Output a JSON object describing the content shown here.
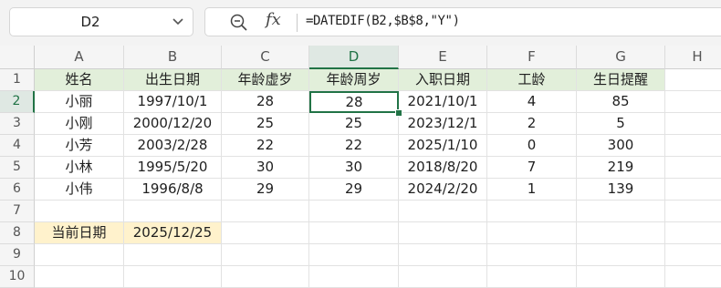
{
  "name_box": {
    "value": "D2"
  },
  "formula_bar": {
    "formula": "=DATEDIF(B2,$B$8,\"Y\")"
  },
  "selected_cell": {
    "column": "D",
    "row": "2"
  },
  "column_headers": [
    "A",
    "B",
    "C",
    "D",
    "E",
    "F",
    "G",
    "H"
  ],
  "row_headers": [
    "1",
    "2",
    "3",
    "4",
    "5",
    "6",
    "7",
    "8",
    "9",
    "10"
  ],
  "table": {
    "headers": [
      "姓名",
      "出生日期",
      "年龄虚岁",
      "年龄周岁",
      "入职日期",
      "工龄",
      "生日提醒"
    ],
    "rows": [
      [
        "小丽",
        "1997/10/1",
        "28",
        "28",
        "2021/10/1",
        "4",
        "85"
      ],
      [
        "小刚",
        "2000/12/20",
        "25",
        "25",
        "2023/12/1",
        "2",
        "5"
      ],
      [
        "小芳",
        "2003/2/28",
        "22",
        "22",
        "2025/1/10",
        "0",
        "300"
      ],
      [
        "小林",
        "1995/5/20",
        "30",
        "30",
        "2018/8/20",
        "7",
        "219"
      ],
      [
        "小伟",
        "1996/8/8",
        "29",
        "29",
        "2024/2/20",
        "1",
        "139"
      ]
    ]
  },
  "current_date": {
    "label": "当前日期",
    "value": "2025/12/25"
  },
  "colors": {
    "header_fill": "#e2efda",
    "date_fill": "#fff2cc",
    "selection": "#217346"
  }
}
